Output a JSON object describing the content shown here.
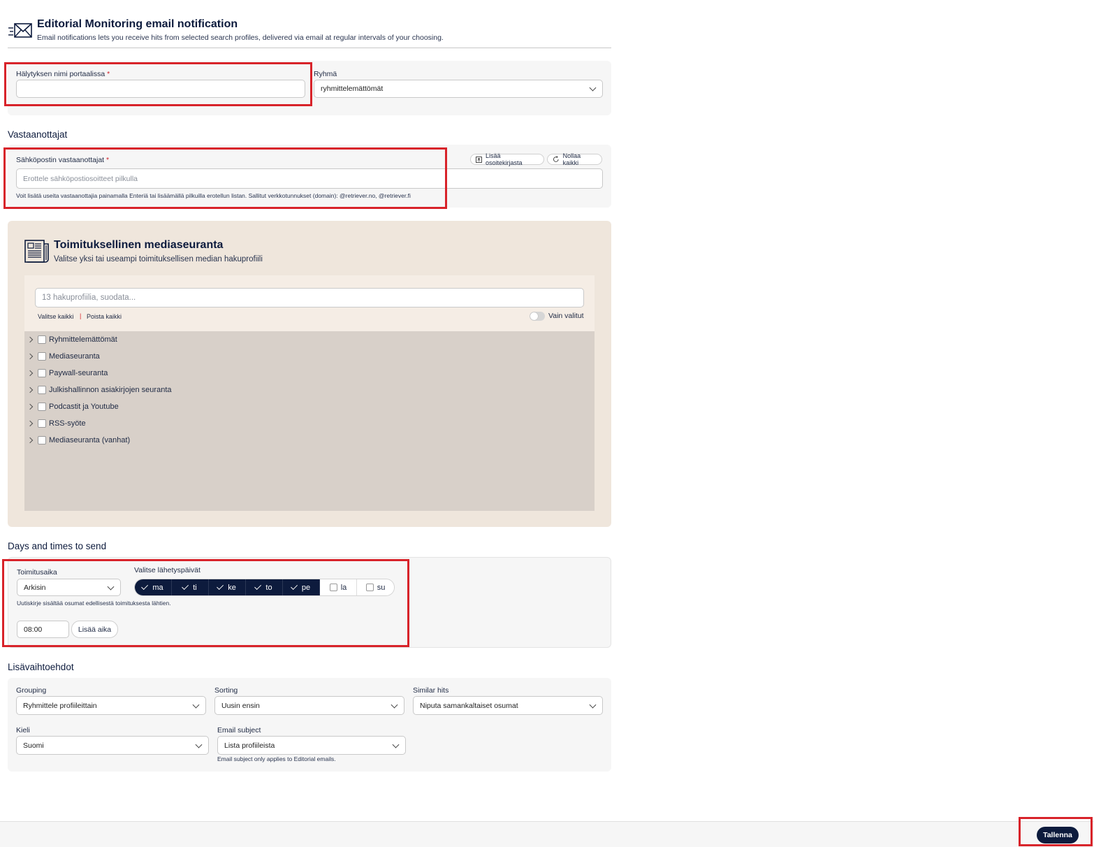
{
  "header": {
    "title": "Editorial Monitoring email notification",
    "subtitle": "Email notifications lets you receive hits from selected search profiles, delivered via email at regular intervals of your choosing.",
    "icon": "email-send-icon"
  },
  "alert_name": {
    "label": "Hälytyksen nimi portaalissa",
    "required_mark": "*",
    "value": ""
  },
  "group": {
    "label": "Ryhmä",
    "value": "ryhmittelemättömät"
  },
  "recipients": {
    "section_title": "Vastaanottajat",
    "label": "Sähköpostin vastaanottajat",
    "required_mark": "*",
    "placeholder": "Erottele sähköpostiosoitteet pilkulla",
    "hint": "Voit lisätä useita vastaanottajia painamalla Enteriä tai lisäämällä pilkuilla erotellun listan. Sallitut verkkotunnukset (domain): @retriever.no, @retriever.fi",
    "add_from_address_book": "Lisää osoitekirjasta",
    "reset_all": "Nollaa kaikki"
  },
  "media": {
    "title": "Toimituksellinen mediaseuranta",
    "subtitle": "Valitse yksi tai useampi toimituksellisen median hakuprofiili",
    "icon": "newspaper-icon",
    "filter_placeholder": "13 hakuprofiilia, suodata...",
    "select_all": "Valitse kaikki",
    "separator": "|",
    "remove_all": "Poista kaikki",
    "only_selected": "Vain valitut",
    "only_selected_on": false,
    "items": [
      "Ryhmittelemättömät",
      "Mediaseuranta",
      "Paywall-seuranta",
      "Julkishallinnon asiakirjojen seuranta",
      "Podcastit ja Youtube",
      "RSS-syöte",
      "Mediaseuranta (vanhat)"
    ]
  },
  "schedule": {
    "section_title": "Days and times to send",
    "delivery_label": "Toimitusaika",
    "delivery_value": "Arkisin",
    "days_label": "Valitse lähetyspäivät",
    "days": [
      {
        "label": "ma",
        "selected": true
      },
      {
        "label": "ti",
        "selected": true
      },
      {
        "label": "ke",
        "selected": true
      },
      {
        "label": "to",
        "selected": true
      },
      {
        "label": "pe",
        "selected": true
      },
      {
        "label": "la",
        "selected": false
      },
      {
        "label": "su",
        "selected": false
      }
    ],
    "hint": "Uutiskirje sisältää osumat edellisestä toimituksesta lähtien.",
    "time_value": "08:00",
    "add_time": "Lisää aika"
  },
  "options": {
    "section_title": "Lisävaihtoehdot",
    "grouping_label": "Grouping",
    "grouping_value": "Ryhmittele profiileittain",
    "sorting_label": "Sorting",
    "sorting_value": "Uusin ensin",
    "similar_label": "Similar hits",
    "similar_value": "Niputa samankaltaiset osumat",
    "language_label": "Kieli",
    "language_value": "Suomi",
    "subject_label": "Email subject",
    "subject_value": "Lista profiileista",
    "subject_hint": "Email subject only applies to Editorial emails."
  },
  "footer": {
    "save": "Tallenna"
  },
  "colors": {
    "primary": "#0d1b3d",
    "highlight": "#d8232a",
    "media_bg": "#efe6dc",
    "list_bg": "#d8d0c9"
  }
}
